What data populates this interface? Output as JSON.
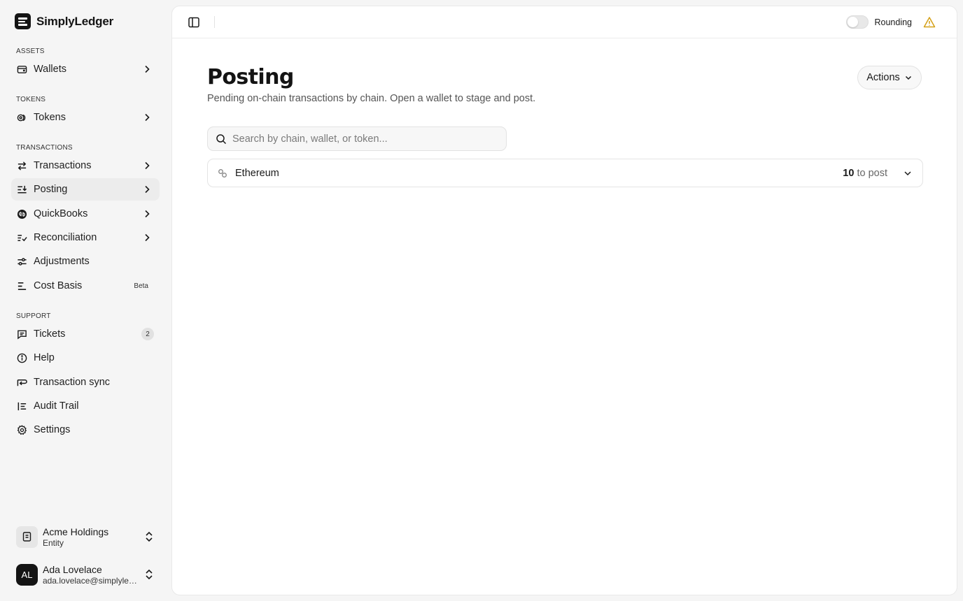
{
  "app": {
    "name": "SimplyLedger"
  },
  "sidebar": {
    "sections": [
      {
        "label": "ASSETS"
      },
      {
        "label": "TOKENS"
      },
      {
        "label": "TRANSACTIONS"
      },
      {
        "label": "SUPPORT"
      }
    ],
    "items": {
      "wallets": {
        "label": "Wallets",
        "icon": "wallet-icon"
      },
      "tokens": {
        "label": "Tokens",
        "icon": "coins-icon"
      },
      "transactions": {
        "label": "Transactions",
        "icon": "arrows-swap-icon"
      },
      "posting": {
        "label": "Posting",
        "icon": "posting-icon",
        "active": true
      },
      "quickbooks": {
        "label": "QuickBooks",
        "icon": "quickbooks-icon"
      },
      "reconciliation": {
        "label": "Reconciliation",
        "icon": "list-check-icon"
      },
      "adjustments": {
        "label": "Adjustments",
        "icon": "sliders-icon"
      },
      "cost_basis": {
        "label": "Cost Basis",
        "icon": "bars-icon",
        "badge": "Beta"
      },
      "tickets": {
        "label": "Tickets",
        "icon": "message-icon",
        "count": "2"
      },
      "help": {
        "label": "Help",
        "icon": "info-icon"
      },
      "transaction_sync": {
        "label": "Transaction sync",
        "icon": "sync-arrow-icon"
      },
      "audit_trail": {
        "label": "Audit Trail",
        "icon": "audit-list-icon"
      },
      "settings": {
        "label": "Settings",
        "icon": "gear-icon"
      }
    },
    "entity": {
      "name": "Acme Holdings",
      "sub": "Entity"
    },
    "user": {
      "initials": "AL",
      "name": "Ada Lovelace",
      "email": "ada.lovelace@simplyledger.com"
    }
  },
  "topbar": {
    "rounding_label": "Rounding",
    "rounding_on": false
  },
  "page": {
    "title": "Posting",
    "subtitle": "Pending on-chain transactions by chain. Open a wallet to stage and post.",
    "actions_label": "Actions",
    "search_placeholder": "Search by chain, wallet, or token...",
    "chains": [
      {
        "name": "Ethereum",
        "count": "10",
        "suffix": "to post"
      }
    ]
  },
  "colors": {
    "brand": "#141414",
    "warning": "#d4a017",
    "surface": "#ffffff",
    "sidebar_bg": "#f5f5f5"
  }
}
